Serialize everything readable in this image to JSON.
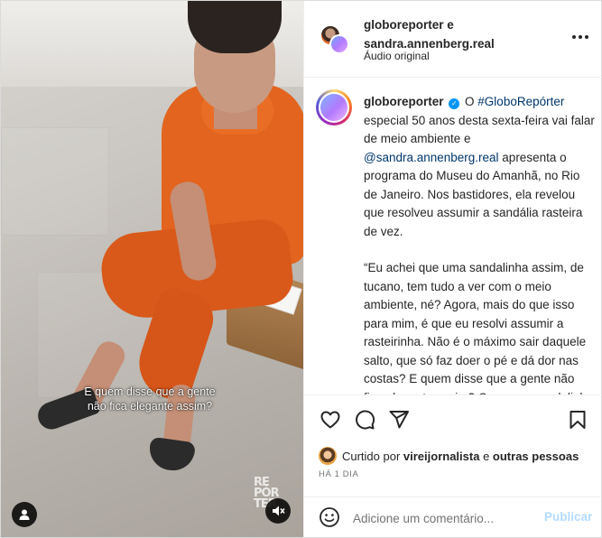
{
  "media": {
    "subtitle_line1": "E quem disse que a gente",
    "subtitle_line2": "não fica elegante assim?",
    "watermark": "RE PÓR TER",
    "user_tags_icon": "person-icon",
    "mute_icon": "speaker-muted-icon"
  },
  "header": {
    "names_line1": "globoreporter e",
    "names_line2": "sandra.annenberg.real",
    "audio": "Áudio original",
    "more_icon": "more-horizontal-icon"
  },
  "caption": {
    "username": "globoreporter",
    "verified_icon": "verified-badge-icon",
    "p1_a": "O ",
    "hashtag": "#GloboRepórter",
    "p1_b": " especial 50 anos desta sexta-feira vai falar de meio ambiente e ",
    "mention": "@sandra.annenberg.real",
    "p1_c": " apresenta o programa do Museu do Amanhã, no Rio de Janeiro. Nos bastidores, ela revelou que resolveu assumir a sandália rasteira de vez.",
    "p2": "“Eu achei que uma sandalinha assim, de tucano, tem tudo a ver com o meio ambiente, né? Agora, mais do que isso para mim, é que eu resolvi assumir a rasteirinha. Não é o máximo sair daquele salto, que só faz doer o pé e dá dor nas costas? E quem disse que a gente não fica elegante assim? Com uma sandalinha sem salto? Me"
  },
  "actions": {
    "like_icon": "heart-icon",
    "comment_icon": "comment-icon",
    "share_icon": "send-icon",
    "save_icon": "bookmark-icon"
  },
  "likes": {
    "prefix": "Curtido por ",
    "user": "vireijornalista",
    "mid": " e ",
    "others": "outras pessoas"
  },
  "time": "HÁ 1 DIA",
  "comment": {
    "emoji_icon": "emoji-icon",
    "placeholder": "Adicione um comentário...",
    "publish_label": "Publicar"
  },
  "colors": {
    "link": "#00376b",
    "verified": "#0095f6",
    "publish_disabled": "#b3dbff",
    "dress": "#e2641e"
  }
}
